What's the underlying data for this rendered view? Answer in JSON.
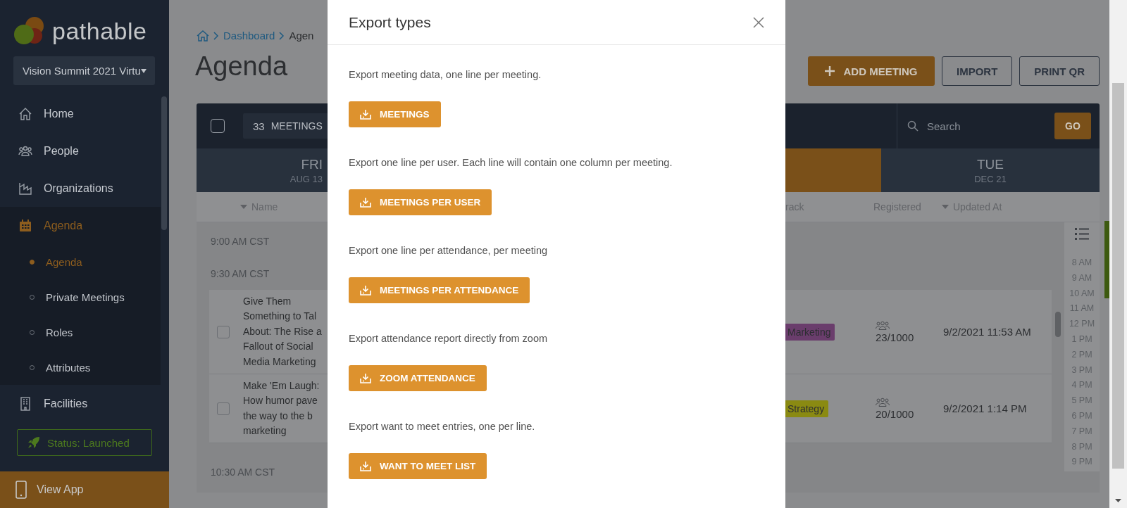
{
  "sidebar": {
    "logo": "pathable",
    "event_selector": "Vision Summit 2021 Virtu",
    "nav": [
      {
        "label": "Home",
        "selected": false
      },
      {
        "label": "People",
        "selected": false
      },
      {
        "label": "Organizations",
        "selected": false
      },
      {
        "label": "Agenda",
        "selected": true,
        "children": [
          {
            "label": "Agenda",
            "selected": true
          },
          {
            "label": "Private Meetings",
            "selected": false
          },
          {
            "label": "Roles",
            "selected": false
          },
          {
            "label": "Attributes",
            "selected": false
          }
        ]
      },
      {
        "label": "Facilities",
        "selected": false
      }
    ],
    "status": "Status: Launched",
    "view_app": "View App"
  },
  "page": {
    "breadcrumb": [
      "Dashboard",
      "Agen"
    ],
    "title": "Agenda",
    "actions": [
      {
        "label": "ADD MEETING",
        "kind": "primary"
      },
      {
        "label": "IMPORT",
        "kind": "outline"
      },
      {
        "label": "PRINT QR",
        "kind": "outline"
      }
    ]
  },
  "toolbar": {
    "all_checked": false,
    "meetings_count": "33",
    "meetings_label": "MEETINGS",
    "search_placeholder": "Search",
    "go": "GO"
  },
  "days": [
    {
      "day": "FRI",
      "date": "AUG 13",
      "selected": false
    },
    {
      "selected": true
    },
    {
      "day": "TUE",
      "date": "DEC 21",
      "selected": false
    }
  ],
  "columns": [
    {
      "label": "Name",
      "sorted": true
    },
    {
      "label": "rack",
      "sorted": false
    },
    {
      "label": "Registered",
      "sorted": false
    },
    {
      "label": "Updated At",
      "sorted": true
    }
  ],
  "groups": [
    {
      "time": "9:00 AM CST"
    },
    {
      "time": "9:30 AM CST",
      "meetings": [
        {
          "title": "Give Them\nSomething to Tal\nAbout: The Rise a\nFallout of Social\nMedia Marketing",
          "checked": false,
          "track": {
            "label": "Marketing",
            "color": "#6a3d6c"
          },
          "registered": "23/1000",
          "updated": "9/2/2021 11:53 AM"
        },
        {
          "title": "Make 'Em Laugh:\nHow humor pave\nthe way to the b\nmarketing",
          "checked": false,
          "track": {
            "label": "Strategy",
            "color": "#8a8a12"
          },
          "registered": "20/1000",
          "updated": "9/2/2021 1:14 PM"
        }
      ]
    },
    {
      "time": "10:30 AM CST"
    }
  ],
  "hour_rail": [
    "8 AM",
    "9 AM",
    "10 AM",
    "11 AM",
    "12 PM",
    "1 PM",
    "2 PM",
    "3 PM",
    "4 PM",
    "5 PM",
    "6 PM",
    "7 PM",
    "8 PM",
    "9 PM"
  ],
  "modal": {
    "title": "Export types",
    "sections": [
      {
        "description": "Export meeting data, one line per meeting.",
        "button": "MEETINGS"
      },
      {
        "description": "Export one line per user. Each line will contain one column per meeting.",
        "button": "MEETINGS PER USER"
      },
      {
        "description": "Export one line per attendance, per meeting",
        "button": "MEETINGS PER ATTENDANCE"
      },
      {
        "description": "Export attendance report directly from zoom",
        "button": "ZOOM ATTENDANCE"
      },
      {
        "description": "Export want to meet entries, one per line.",
        "button": "WANT TO MEET LIST"
      }
    ]
  }
}
